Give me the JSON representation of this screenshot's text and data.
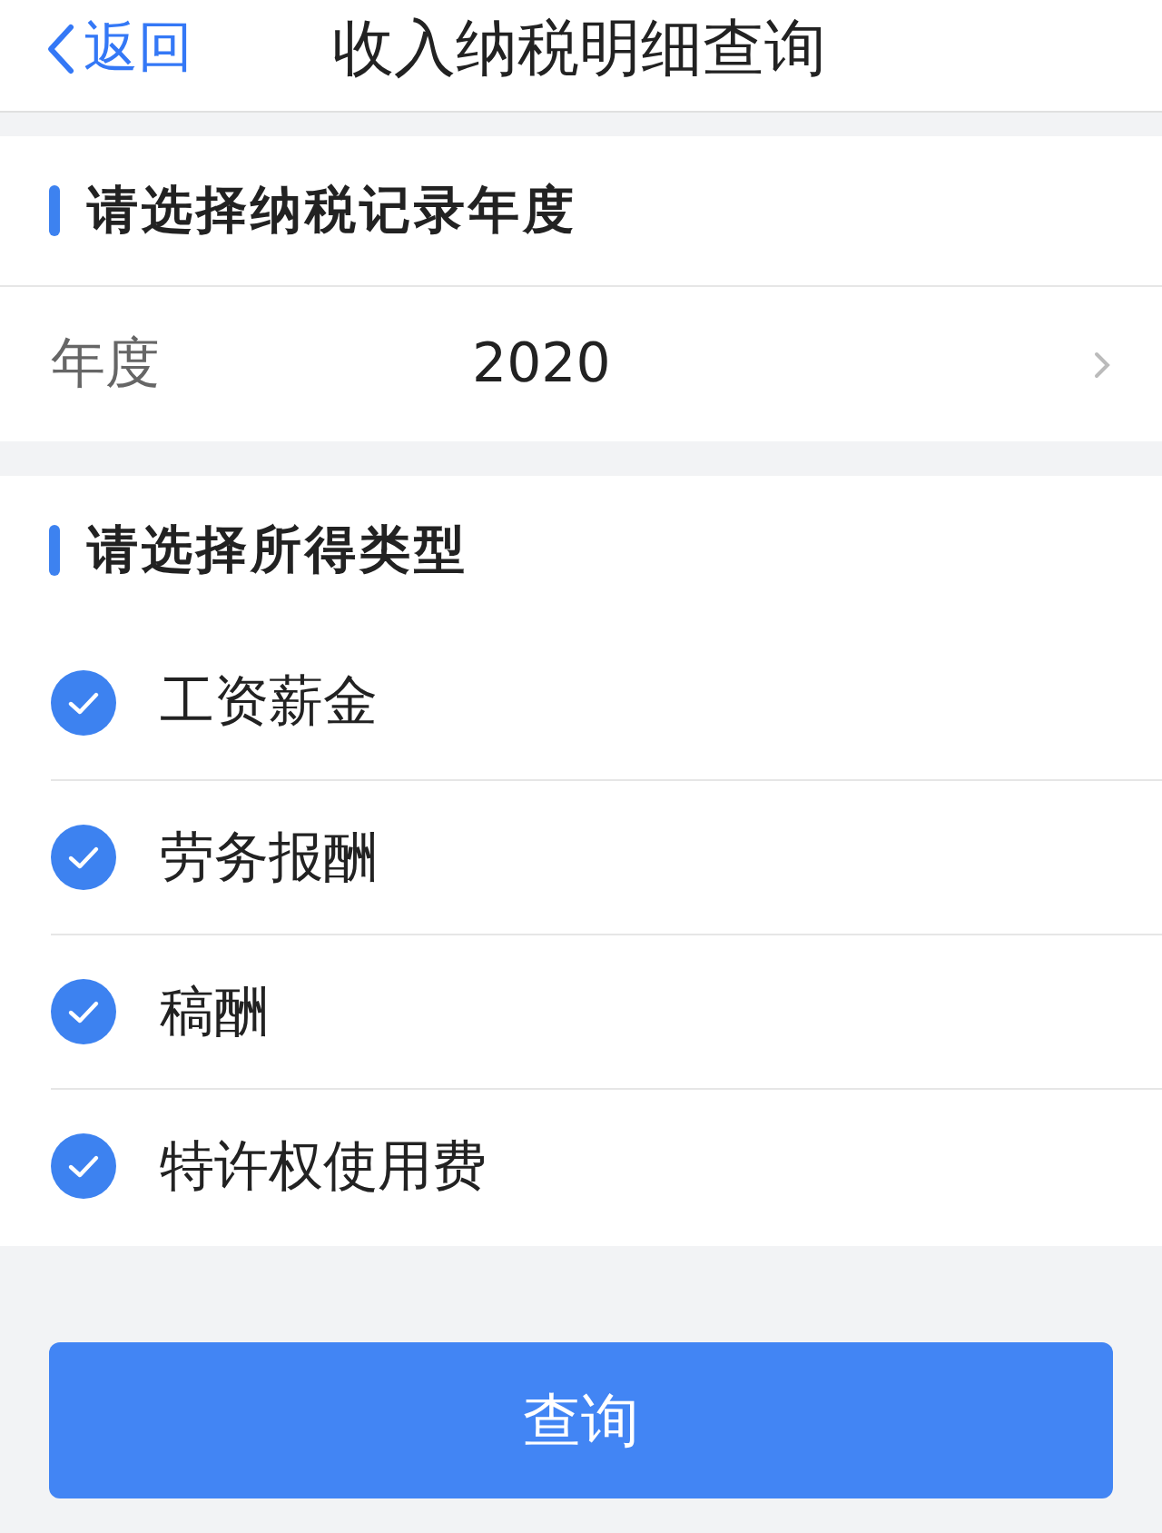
{
  "header": {
    "back_label": "返回",
    "title": "收入纳税明细查询"
  },
  "year_section": {
    "title": "请选择纳税记录年度",
    "label": "年度",
    "value": "2020"
  },
  "type_section": {
    "title": "请选择所得类型",
    "items": [
      {
        "label": "工资薪金",
        "checked": true
      },
      {
        "label": "劳务报酬",
        "checked": true
      },
      {
        "label": "稿酬",
        "checked": true
      },
      {
        "label": "特许权使用费",
        "checked": true
      }
    ]
  },
  "query_button": "查询"
}
